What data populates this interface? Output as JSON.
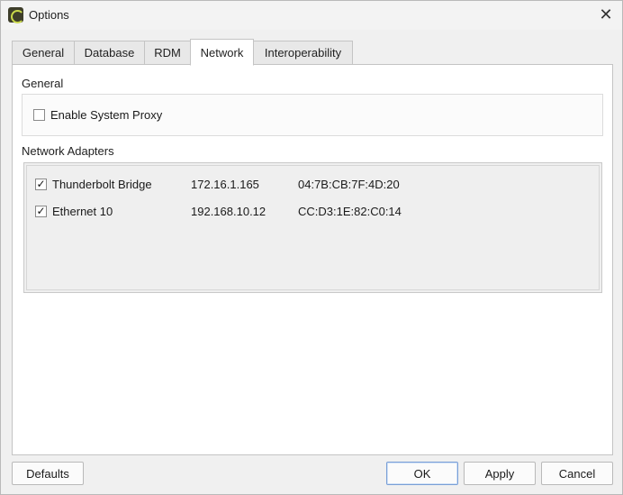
{
  "window": {
    "title": "Options",
    "close_glyph": "✕"
  },
  "tabs": [
    {
      "label": "General",
      "active": false
    },
    {
      "label": "Database",
      "active": false
    },
    {
      "label": "RDM",
      "active": false
    },
    {
      "label": "Network",
      "active": true
    },
    {
      "label": "Interoperability",
      "active": false
    }
  ],
  "general": {
    "heading": "General",
    "enable_system_proxy": {
      "label": "Enable System Proxy",
      "checked": false,
      "mark": ""
    }
  },
  "adapters": {
    "heading": "Network Adapters",
    "rows": [
      {
        "name": "Thunderbolt Bridge",
        "ip": "172.16.1.165",
        "mac": "04:7B:CB:7F:4D:20",
        "checked": true,
        "mark": "✓"
      },
      {
        "name": "Ethernet 10",
        "ip": "192.168.10.12",
        "mac": "CC:D3:1E:82:C0:14",
        "checked": true,
        "mark": "✓"
      }
    ]
  },
  "buttons": {
    "defaults": "Defaults",
    "ok": "OK",
    "apply": "Apply",
    "cancel": "Cancel"
  },
  "icons": {
    "app": "app-logo-icon",
    "close": "close-icon",
    "check": "checkmark-icon"
  },
  "colors": {
    "panel_bg": "#ffffff",
    "window_bg": "#f0f0f0",
    "default_button_border": "#7a9fd6"
  }
}
